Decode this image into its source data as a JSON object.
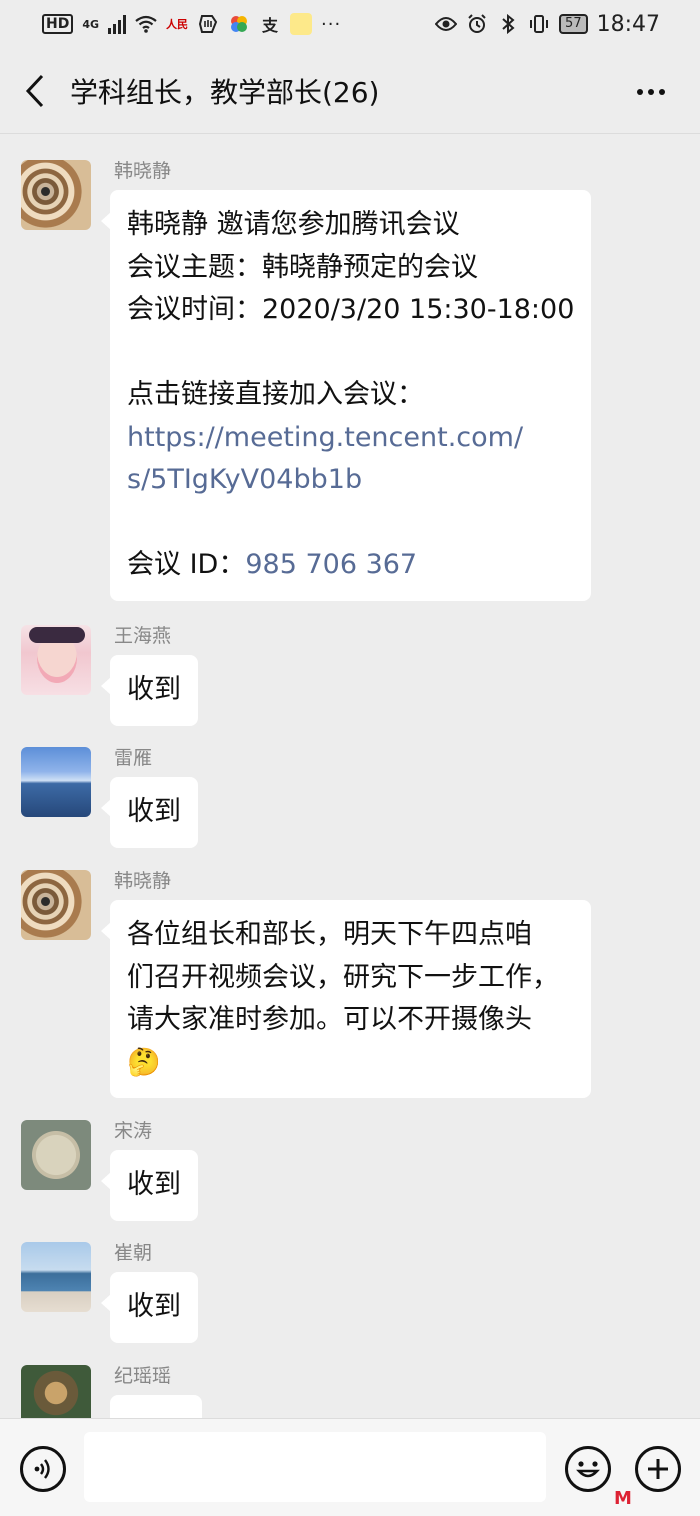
{
  "status": {
    "hd": "HD",
    "network": "4G",
    "app_icons": [
      "people-daily-icon",
      "hand-icon",
      "photos-icon",
      "alipay-icon",
      "note-icon"
    ],
    "overflow": "···",
    "battery": "57",
    "time": "18:47"
  },
  "nav": {
    "title": "学科组长，教学部长(26)"
  },
  "messages": [
    {
      "sender": "韩晓静",
      "avatar": "snail-avatar",
      "lines": [
        "韩晓静 邀请您参加腾讯会议",
        "会议主题：韩晓静预定的会议",
        "会议时间：2020/3/20 15:30-18:00",
        "",
        "点击链接直接加入会议：",
        "https://meeting.tencent.com/",
        "s/5TIgKyV04bb1b",
        "",
        "会议 ID：",
        "985 706 367"
      ]
    },
    {
      "sender": "王海燕",
      "avatar": "opera-avatar",
      "text": "收到"
    },
    {
      "sender": "雷雁",
      "avatar": "sea-avatar",
      "text": "收到"
    },
    {
      "sender": "韩晓静",
      "avatar": "snail-avatar",
      "lines": [
        "各位组长和部长，明天下午四点咱",
        "们召开视频会议，研究下一步工作，",
        "请大家准时参加。可以不开摄像头",
        "🤔"
      ]
    },
    {
      "sender": "宋涛",
      "avatar": "plant-avatar",
      "text": "收到"
    },
    {
      "sender": "崔朝",
      "avatar": "beach-avatar",
      "text": "收到"
    },
    {
      "sender": "纪瑶瑶",
      "avatar": "mona-avatar",
      "text": ""
    }
  ],
  "input": {
    "value": "",
    "placeholder": ""
  },
  "colors": {
    "background": "#ededed",
    "bubble": "#ffffff",
    "link": "#576b95",
    "sender": "#888888"
  }
}
